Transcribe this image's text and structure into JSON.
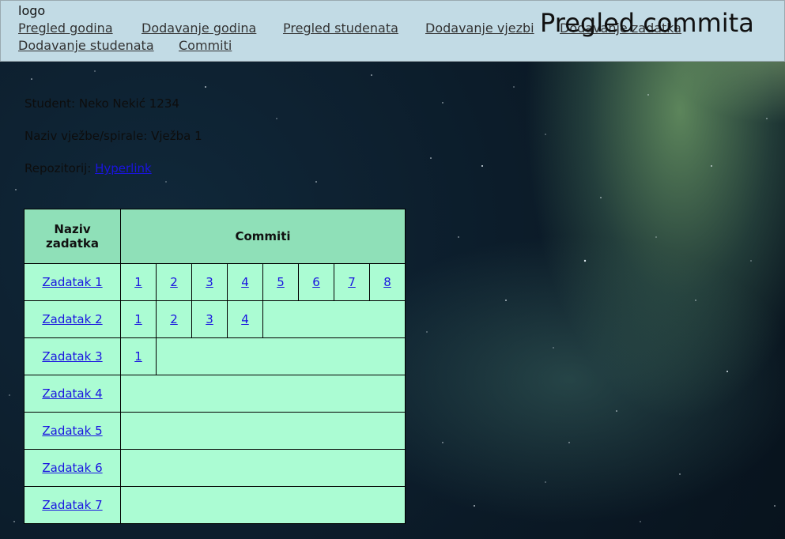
{
  "header": {
    "logo": "logo",
    "nav": [
      "Pregled godina",
      "Dodavanje godina",
      "Pregled studenata",
      "Dodavanje vjezbi",
      "Dodavanje zadatka",
      "Dodavanje studenata",
      "Commiti"
    ],
    "title": "Pregled commita"
  },
  "info": {
    "student": "Student: Neko Nekić 1234",
    "exercise": "Naziv vježbe/spirale: Vježba 1",
    "repo_label": "Repozitorij: ",
    "repo_link": "Hyperlink"
  },
  "table": {
    "headers": [
      "Naziv zadatka",
      "Commiti"
    ],
    "rows": [
      {
        "task": "Zadatak 1",
        "commits": [
          "1",
          "2",
          "3",
          "4",
          "5",
          "6",
          "7",
          "8"
        ]
      },
      {
        "task": "Zadatak 2",
        "commits": [
          "1",
          "2",
          "3",
          "4"
        ]
      },
      {
        "task": "Zadatak 3",
        "commits": [
          "1"
        ]
      },
      {
        "task": "Zadatak 4",
        "commits": []
      },
      {
        "task": "Zadatak 5",
        "commits": []
      },
      {
        "task": "Zadatak 6",
        "commits": []
      },
      {
        "task": "Zadatak 7",
        "commits": []
      }
    ]
  },
  "colors": {
    "header_bg": "#c2dbe5",
    "table_header_bg": "#8fe0b8",
    "table_cell_bg": "#abfcd3",
    "link": "#1a14e0"
  }
}
